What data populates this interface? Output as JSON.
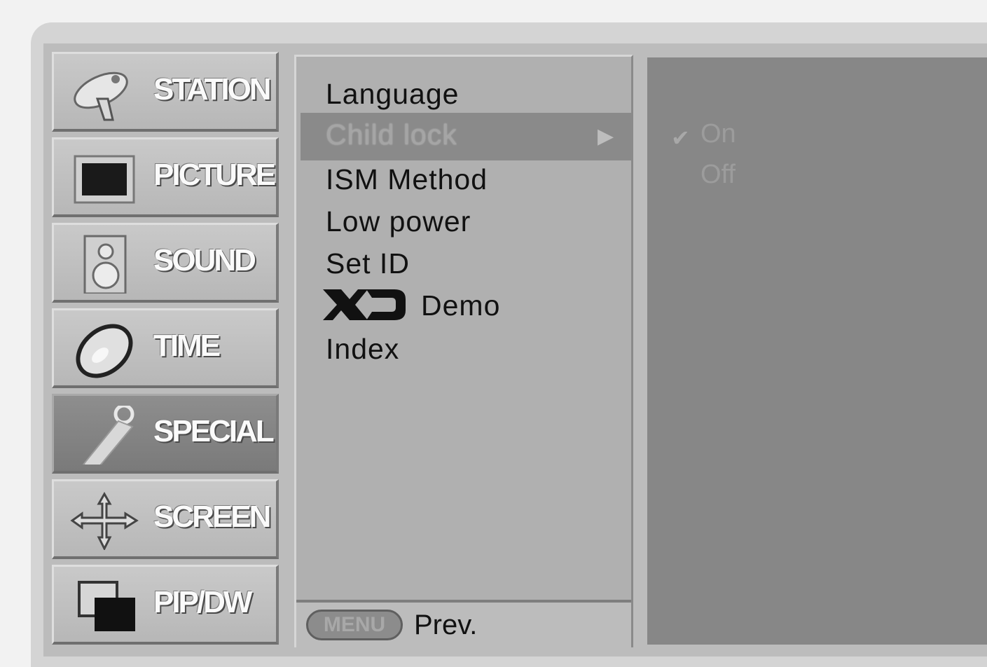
{
  "menu": {
    "items": [
      {
        "label": "STATION",
        "icon": "satellite-dish-icon"
      },
      {
        "label": "PICTURE",
        "icon": "tv-screen-icon"
      },
      {
        "label": "SOUND",
        "icon": "speaker-icon"
      },
      {
        "label": "TIME",
        "icon": "clock-icon"
      },
      {
        "label": "SPECIAL",
        "icon": "key-tag-icon",
        "active": true
      },
      {
        "label": "SCREEN",
        "icon": "move-arrows-icon"
      },
      {
        "label": "PIP/DW",
        "icon": "pip-windows-icon"
      }
    ]
  },
  "submenu": {
    "items": [
      {
        "label": "Language"
      },
      {
        "label": "Child lock",
        "selected": true
      },
      {
        "label": "ISM Method"
      },
      {
        "label": "Low power"
      },
      {
        "label": "Set ID"
      },
      {
        "label": "Demo",
        "logo": "XD"
      },
      {
        "label": "Index"
      }
    ],
    "arrow": "▶"
  },
  "footer": {
    "menu_button": "MENU",
    "prev_label": "Prev."
  },
  "options": {
    "on_label": "On",
    "off_label": "Off",
    "check": "✔"
  }
}
